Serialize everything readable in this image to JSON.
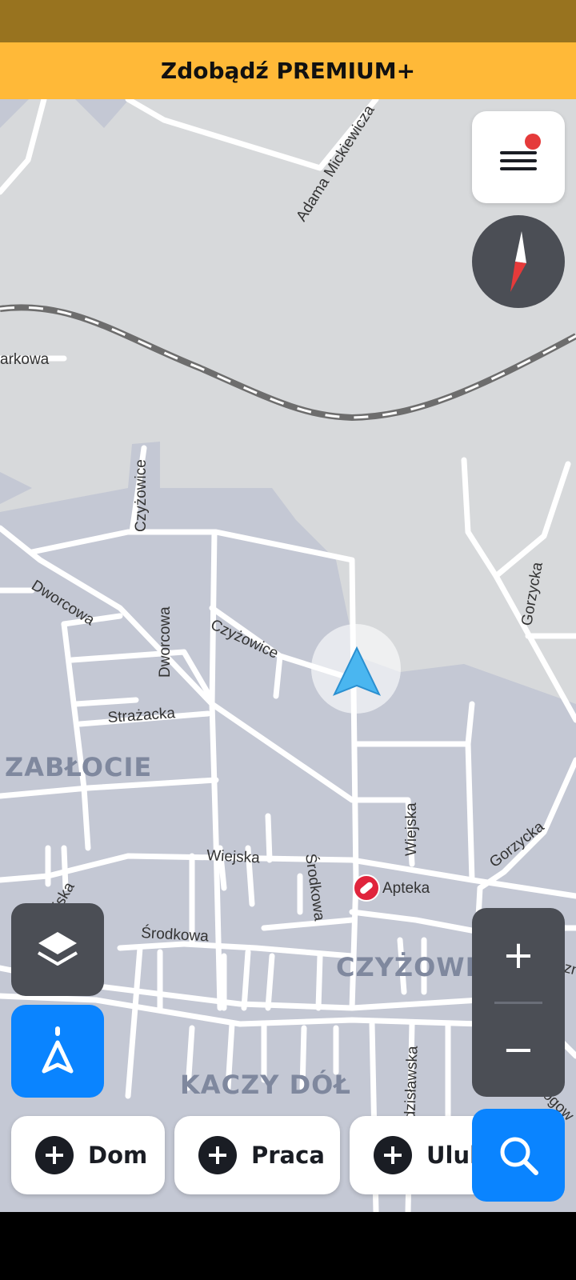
{
  "banner": {
    "text": "Zdobądź PREMIUM+"
  },
  "map": {
    "street_labels": {
      "adama_mickiewicza": "Adama Mickiewicza",
      "parkowa": "arkowa",
      "czyzowice_vertical": "Czyżowice",
      "czyzowice_diag": "Czyżowice",
      "dworcowa_diag": "Dworcowa",
      "dworcowa_vert": "Dworcowa",
      "strazacka": "Strażacka",
      "gorzycka_small": "Gorzycka",
      "gorzycka_big": "Gorzycka",
      "wiejska_1": "Wiejska",
      "wiejska_2": "Wiejska",
      "wiejska_3": "Wiejska",
      "srodkowa_1": "Środkowa",
      "srodkowa_2": "Środkowa",
      "belsznica": "Belszn",
      "wodzislawska": "odzisławska",
      "rogow": "Rogow"
    },
    "districts": {
      "zablocie": "ZABŁOCIE",
      "czyzowice": "CZYŻOWICE",
      "kaczy_dol": "KACZY DÓŁ"
    },
    "poi": {
      "apteka": "Apteka"
    },
    "colors": {
      "residential": "#c4c8d4",
      "road": "#ffffff",
      "railway": "#6d6d6d",
      "position": "#4ab6f0",
      "pharmacy": "#e0243c"
    }
  },
  "controls": {
    "menu_icon": "hamburger-menu-icon",
    "compass_icon": "compass-needle-icon",
    "layers_icon": "layers-icon",
    "navigate_icon": "navigation-arrow-icon",
    "zoom_in_label": "+",
    "zoom_out_label": "−",
    "search_icon": "search-icon"
  },
  "shortcuts": [
    {
      "label": "Dom"
    },
    {
      "label": "Praca"
    },
    {
      "label": "Ulub"
    }
  ]
}
